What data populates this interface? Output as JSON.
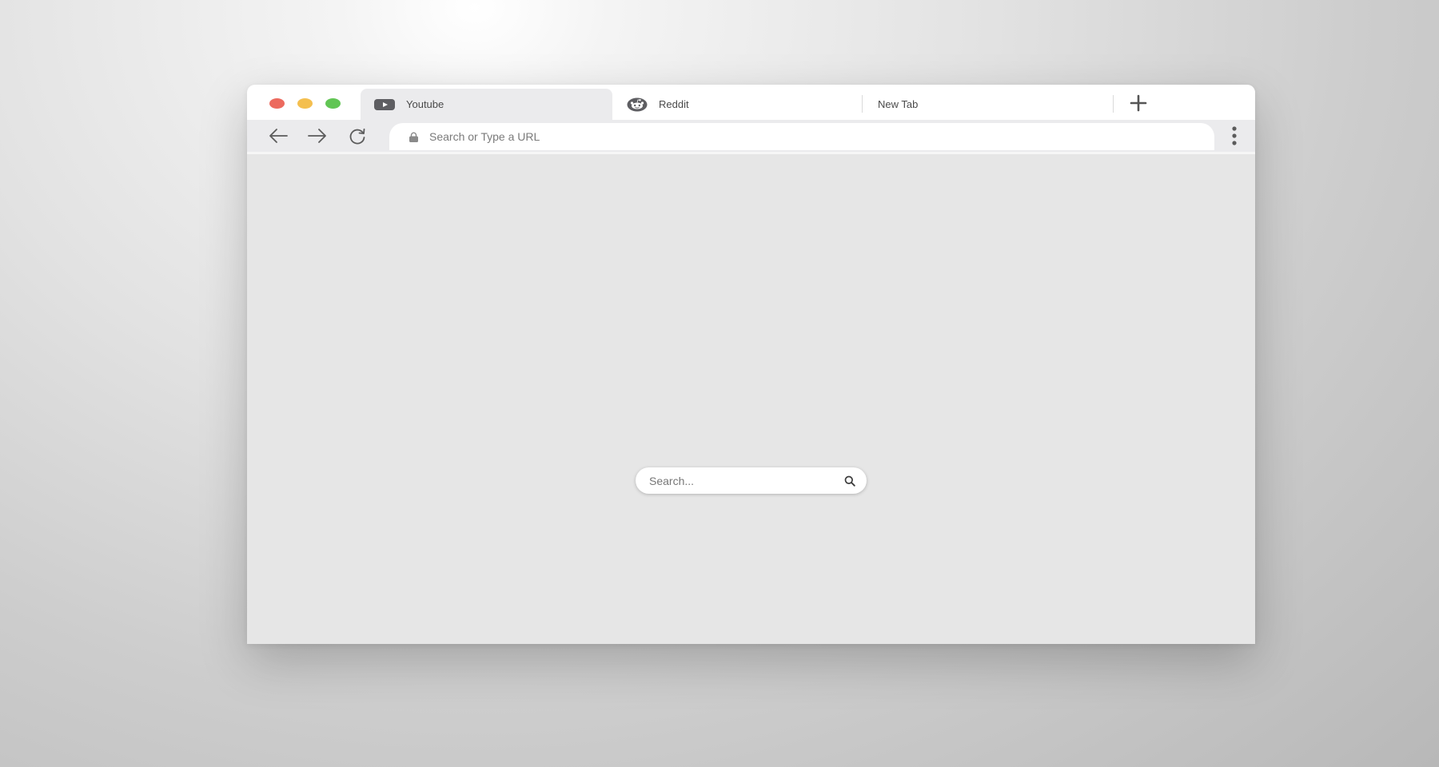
{
  "browser": {
    "traffic_lights": {
      "close_color": "#ec6a5e",
      "minimize_color": "#f4bf4f",
      "maximize_color": "#61c554"
    },
    "tabs": [
      {
        "label": "Youtube",
        "icon": "youtube-icon",
        "active": true
      },
      {
        "label": "Reddit",
        "icon": "reddit-icon",
        "active": false
      },
      {
        "label": "New Tab",
        "icon": null,
        "active": false
      }
    ],
    "new_tab_icon": "plus-icon"
  },
  "toolbar": {
    "back_icon": "arrow-left-icon",
    "forward_icon": "arrow-right-icon",
    "reload_icon": "reload-icon",
    "address_bar": {
      "value": "",
      "placeholder": "Search or Type a URL",
      "icon": "lock-icon"
    },
    "menu_icon": "kebab-menu-icon"
  },
  "page": {
    "search": {
      "value": "",
      "placeholder": "Search...",
      "icon": "search-icon"
    }
  }
}
